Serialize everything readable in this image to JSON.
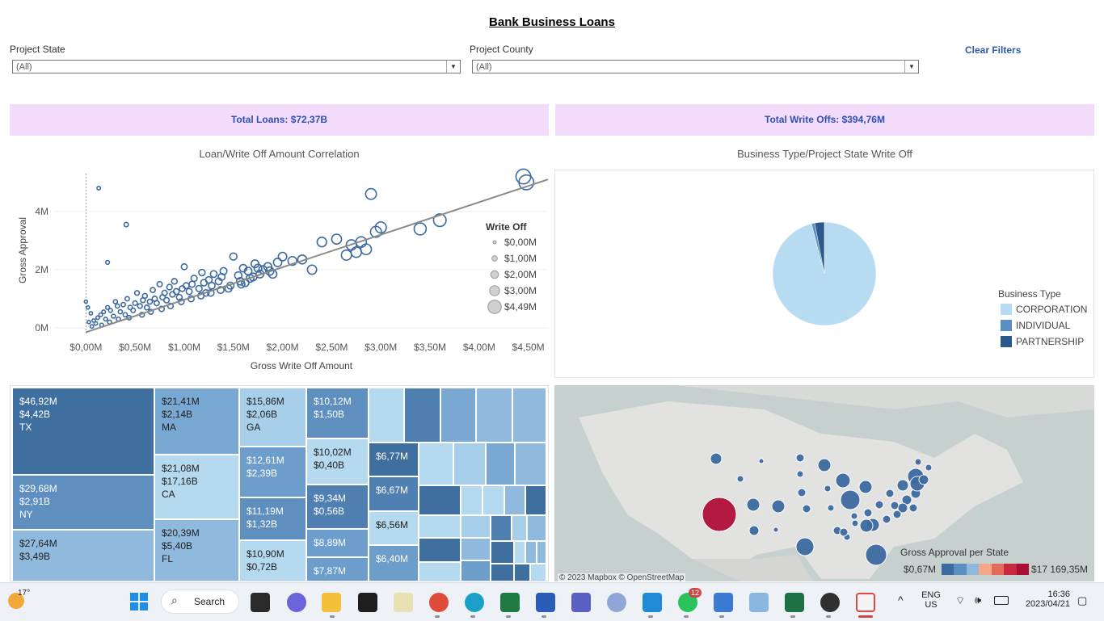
{
  "dashboard": {
    "title": "Bank Business Loans",
    "filters": [
      {
        "label": "Project State",
        "value": "(All)"
      },
      {
        "label": "Project County",
        "value": "(All)"
      }
    ],
    "clear_filters": "Clear Filters",
    "kpis": {
      "total_loans": "Total Loans: $72,37B",
      "total_write_offs": "Total Write Offs: $394,76M"
    },
    "colors": {
      "kpi_bg": "#f3dcfb",
      "kpi_text": "#2f4fb0",
      "link": "#2a5ca8",
      "dark_blue": "#2e5a8c",
      "light_blue": "#b7dbf0",
      "highlight_red": "#b0103a"
    }
  },
  "chart_data": [
    {
      "type": "scatter",
      "title": "Loan/Write Off Amount Correlation",
      "xlabel": "Gross Write Off Amount",
      "ylabel": "Gross Approval",
      "x_ticks": [
        "$0,00M",
        "$0,50M",
        "$1,00M",
        "$1,50M",
        "$2,00M",
        "$2,50M",
        "$3,00M",
        "$3,50M",
        "$4,00M",
        "$4,50M"
      ],
      "y_ticks": [
        "0M",
        "2M",
        "4M"
      ],
      "xlim": [
        -0.2,
        4.7
      ],
      "ylim": [
        -0.25,
        5.3
      ],
      "trend_line": {
        "from": [
          0,
          -0.15
        ],
        "to": [
          4.7,
          5.1
        ]
      },
      "size_legend": {
        "title": "Write Off",
        "labels": [
          "$0,00M",
          "$1,00M",
          "$2,00M",
          "$3,00M",
          "$4,49M"
        ],
        "values": [
          0,
          1,
          2,
          3,
          4.49
        ]
      },
      "points": [
        [
          0.13,
          4.8
        ],
        [
          0.41,
          3.55
        ],
        [
          0.22,
          2.25
        ],
        [
          0.0,
          0.9
        ],
        [
          0.02,
          0.7
        ],
        [
          0.05,
          0.5
        ],
        [
          0.03,
          0.2
        ],
        [
          0.06,
          0.05
        ],
        [
          0.1,
          0.15
        ],
        [
          0.12,
          0.35
        ],
        [
          0.15,
          0.45
        ],
        [
          0.18,
          0.55
        ],
        [
          0.2,
          0.3
        ],
        [
          0.22,
          0.7
        ],
        [
          0.25,
          0.6
        ],
        [
          0.28,
          0.4
        ],
        [
          0.3,
          0.9
        ],
        [
          0.32,
          0.75
        ],
        [
          0.35,
          0.55
        ],
        [
          0.38,
          0.8
        ],
        [
          0.4,
          0.45
        ],
        [
          0.42,
          1.0
        ],
        [
          0.45,
          0.7
        ],
        [
          0.48,
          0.6
        ],
        [
          0.5,
          0.85
        ],
        [
          0.52,
          1.2
        ],
        [
          0.55,
          0.75
        ],
        [
          0.58,
          0.95
        ],
        [
          0.6,
          1.1
        ],
        [
          0.62,
          0.7
        ],
        [
          0.65,
          0.9
        ],
        [
          0.68,
          1.3
        ],
        [
          0.7,
          1.0
        ],
        [
          0.72,
          0.85
        ],
        [
          0.75,
          1.5
        ],
        [
          0.78,
          1.05
        ],
        [
          0.8,
          1.2
        ],
        [
          0.82,
          0.95
        ],
        [
          0.85,
          1.4
        ],
        [
          0.88,
          1.15
        ],
        [
          0.9,
          1.6
        ],
        [
          0.92,
          1.25
        ],
        [
          0.95,
          1.05
        ],
        [
          0.98,
          1.35
        ],
        [
          1.0,
          2.1
        ],
        [
          1.02,
          1.45
        ],
        [
          1.05,
          1.25
        ],
        [
          1.08,
          1.5
        ],
        [
          1.1,
          1.7
        ],
        [
          1.15,
          1.35
        ],
        [
          1.18,
          1.9
        ],
        [
          1.2,
          1.55
        ],
        [
          1.22,
          1.2
        ],
        [
          1.25,
          1.65
        ],
        [
          1.28,
          1.45
        ],
        [
          1.3,
          1.85
        ],
        [
          1.35,
          1.6
        ],
        [
          1.38,
          1.75
        ],
        [
          1.4,
          1.95
        ],
        [
          1.45,
          1.35
        ],
        [
          1.5,
          2.45
        ],
        [
          1.55,
          1.8
        ],
        [
          1.58,
          1.5
        ],
        [
          1.6,
          2.05
        ],
        [
          1.62,
          1.55
        ],
        [
          1.65,
          1.95
        ],
        [
          1.7,
          1.75
        ],
        [
          1.72,
          2.2
        ],
        [
          1.75,
          2.05
        ],
        [
          1.8,
          2.0
        ],
        [
          1.85,
          2.1
        ],
        [
          1.9,
          1.85
        ],
        [
          1.95,
          2.25
        ],
        [
          2.0,
          2.45
        ],
        [
          2.1,
          2.3
        ],
        [
          2.2,
          2.35
        ],
        [
          2.3,
          2.0
        ],
        [
          2.4,
          2.95
        ],
        [
          2.55,
          3.05
        ],
        [
          2.65,
          2.5
        ],
        [
          2.7,
          2.85
        ],
        [
          2.75,
          2.6
        ],
        [
          2.8,
          2.95
        ],
        [
          2.85,
          2.7
        ],
        [
          2.9,
          4.6
        ],
        [
          2.95,
          3.3
        ],
        [
          3.0,
          3.45
        ],
        [
          3.4,
          3.4
        ],
        [
          3.6,
          3.7
        ],
        [
          4.45,
          5.2
        ],
        [
          4.48,
          5.0
        ],
        [
          0.08,
          0.25
        ],
        [
          0.16,
          0.1
        ],
        [
          0.24,
          0.2
        ],
        [
          0.33,
          0.3
        ],
        [
          0.44,
          0.35
        ],
        [
          0.57,
          0.45
        ],
        [
          0.66,
          0.55
        ],
        [
          0.77,
          0.65
        ],
        [
          0.86,
          0.75
        ],
        [
          0.97,
          0.9
        ],
        [
          1.07,
          1.0
        ],
        [
          1.17,
          1.1
        ],
        [
          1.27,
          1.2
        ],
        [
          1.37,
          1.3
        ],
        [
          1.47,
          1.45
        ],
        [
          1.57,
          1.6
        ],
        [
          1.67,
          1.7
        ],
        [
          1.77,
          1.85
        ],
        [
          1.87,
          1.95
        ]
      ]
    },
    {
      "type": "pie",
      "title": "Business Type/Project State Write Off",
      "legend_title": "Business Type",
      "slices": [
        {
          "label": "CORPORATION",
          "value": 96,
          "color": "#b7dbf0"
        },
        {
          "label": "INDIVIDUAL",
          "value": 1,
          "color": "#5b8fc2"
        },
        {
          "label": "PARTNERSHIP",
          "value": 3,
          "color": "#2b5a8a"
        }
      ]
    },
    {
      "type": "treemap",
      "tiles": [
        {
          "lines": [
            "$46,92M",
            "$4,42B",
            "TX"
          ],
          "color": "#3f6f9f"
        },
        {
          "lines": [
            "$29,68M",
            "$2,91B",
            "NY"
          ],
          "color": "#5e8fbf"
        },
        {
          "lines": [
            "$27,64M",
            "$3,49B",
            ""
          ],
          "color": "#8fbadd"
        },
        {
          "lines": [
            "$21,41M",
            "$2,14B",
            "MA"
          ],
          "color": "#79a8d2"
        },
        {
          "lines": [
            "$21,08M",
            "$17,16B",
            "CA"
          ],
          "color": "#b5d9ef"
        },
        {
          "lines": [
            "$20,39M",
            "$5,40B",
            "FL"
          ],
          "color": "#8fbadd"
        },
        {
          "lines": [
            "$15,86M",
            "$2,06B",
            "GA"
          ],
          "color": "#a8cfea"
        },
        {
          "lines": [
            "$12,61M",
            "$2,39B",
            ""
          ],
          "color": "#6d9dcb"
        },
        {
          "lines": [
            "$11,19M",
            "$1,32B",
            ""
          ],
          "color": "#5e8fbf"
        },
        {
          "lines": [
            "$10,90M",
            "$0,72B",
            ""
          ],
          "color": "#b5d9ef"
        },
        {
          "lines": [
            "$10,12M",
            "$1,50B",
            ""
          ],
          "color": "#5e8fbf"
        },
        {
          "lines": [
            "$10,02M",
            "$0,40B",
            ""
          ],
          "color": "#b5d9ef"
        },
        {
          "lines": [
            "$9,34M",
            "$0,56B",
            ""
          ],
          "color": "#4f80b1"
        },
        {
          "lines": [
            "$8,89M"
          ],
          "color": "#6d9dcb"
        },
        {
          "lines": [
            "$7,87M"
          ],
          "color": "#6d9dcb"
        },
        {
          "lines": [
            "$6,77M"
          ],
          "color": "#3f6f9f"
        },
        {
          "lines": [
            "$6,67M"
          ],
          "color": "#4f80b1"
        },
        {
          "lines": [
            "$6,56M"
          ],
          "color": "#b5d9ef"
        },
        {
          "lines": [
            "$6,40M"
          ],
          "color": "#6d9dcb"
        }
      ]
    },
    {
      "type": "map",
      "legend_title": "Gross Approval per State",
      "legend_min": "$0,67M",
      "legend_max": "$17 169,35M",
      "attribution": "© 2023 Mapbox © OpenStreetMap"
    }
  ],
  "taskbar": {
    "weather": "17°",
    "search": "Search",
    "whatsapp_badge": "12",
    "lang_top": "ENG",
    "lang_bottom": "US",
    "time": "16:36",
    "date": "2023/04/21"
  }
}
